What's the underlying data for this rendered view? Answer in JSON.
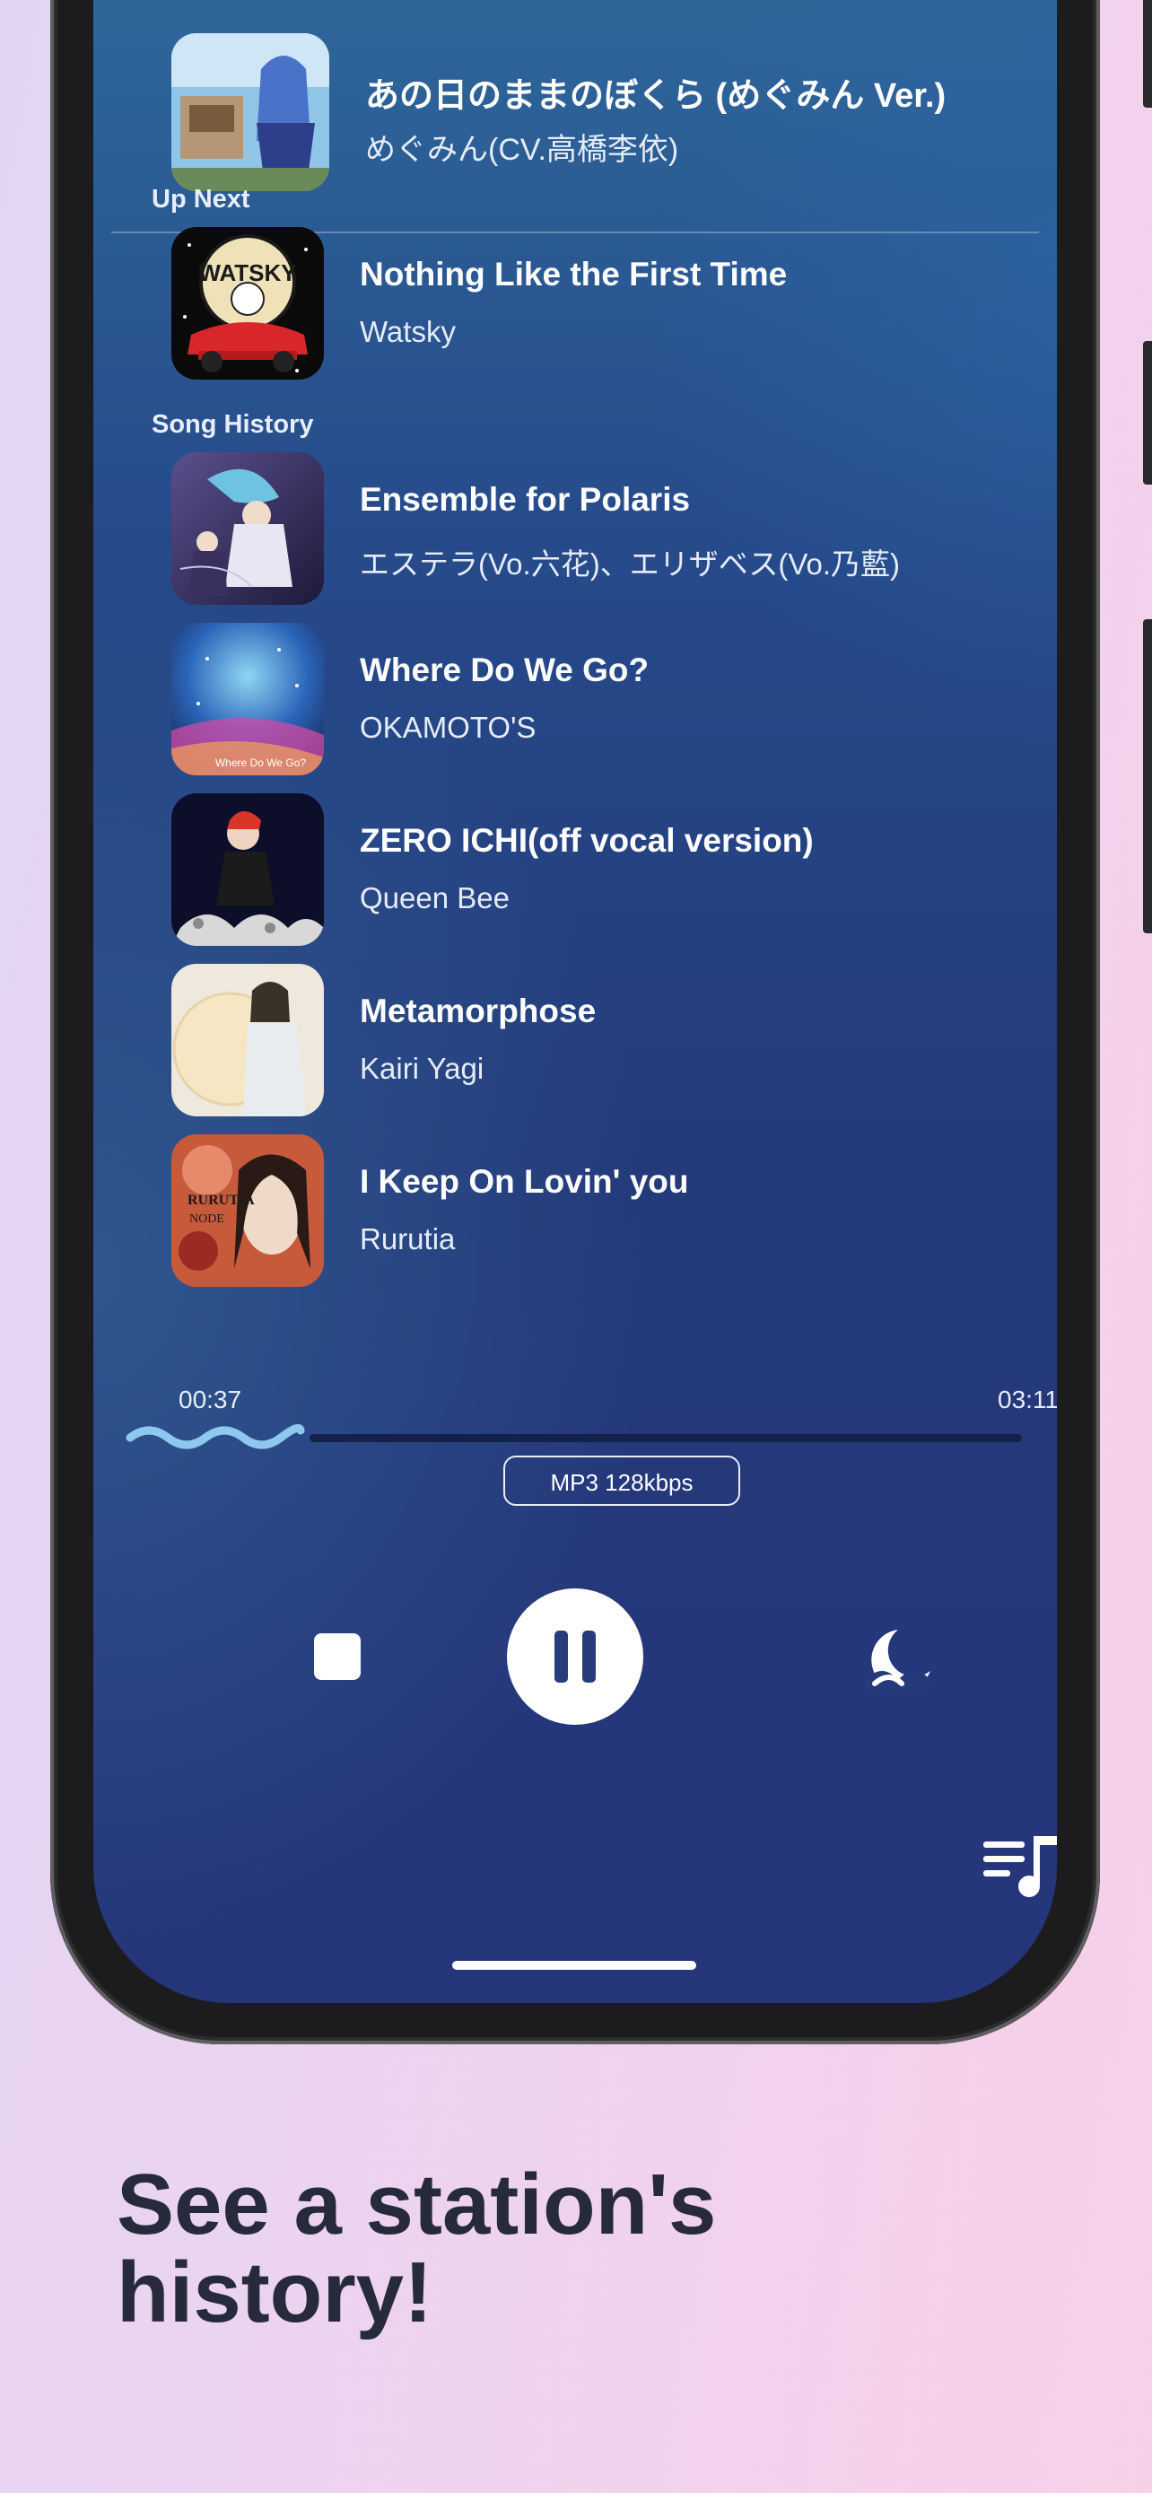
{
  "now_playing": {
    "title": "あの日のままのぼくら (めぐみん Ver.)",
    "artist": "めぐみん(CV.高橋李依)"
  },
  "up_next": {
    "label": "Up Next",
    "items": [
      {
        "title": "Nothing Like the First Time",
        "artist": "Watsky"
      }
    ]
  },
  "history": {
    "label": "Song History",
    "items": [
      {
        "title": "Ensemble for Polaris",
        "artist": "エステラ(Vo.六花)、エリザベス(Vo.乃藍)"
      },
      {
        "title": "Where Do We Go?",
        "artist": "OKAMOTO'S"
      },
      {
        "title": "ZERO ICHI(off vocal version)",
        "artist": "Queen Bee"
      },
      {
        "title": "Metamorphose",
        "artist": "Kairi Yagi"
      },
      {
        "title": "I Keep On Lovin' you",
        "artist": "Rurutia"
      }
    ]
  },
  "playback": {
    "elapsed": "00:37",
    "duration": "03:11",
    "format": "MP3 128kbps",
    "progress_fraction": 0.19
  },
  "controls": {
    "stop_icon": "stop-icon",
    "pause_icon": "pause-icon",
    "sleep_icon": "sleep-timer-icon",
    "queue_icon": "queue-music-icon"
  },
  "headline": {
    "line1": "See a station's",
    "line2": "history!"
  },
  "colors": {
    "accent_wave": "#8ec8ee",
    "headline_text": "#262a3b"
  }
}
